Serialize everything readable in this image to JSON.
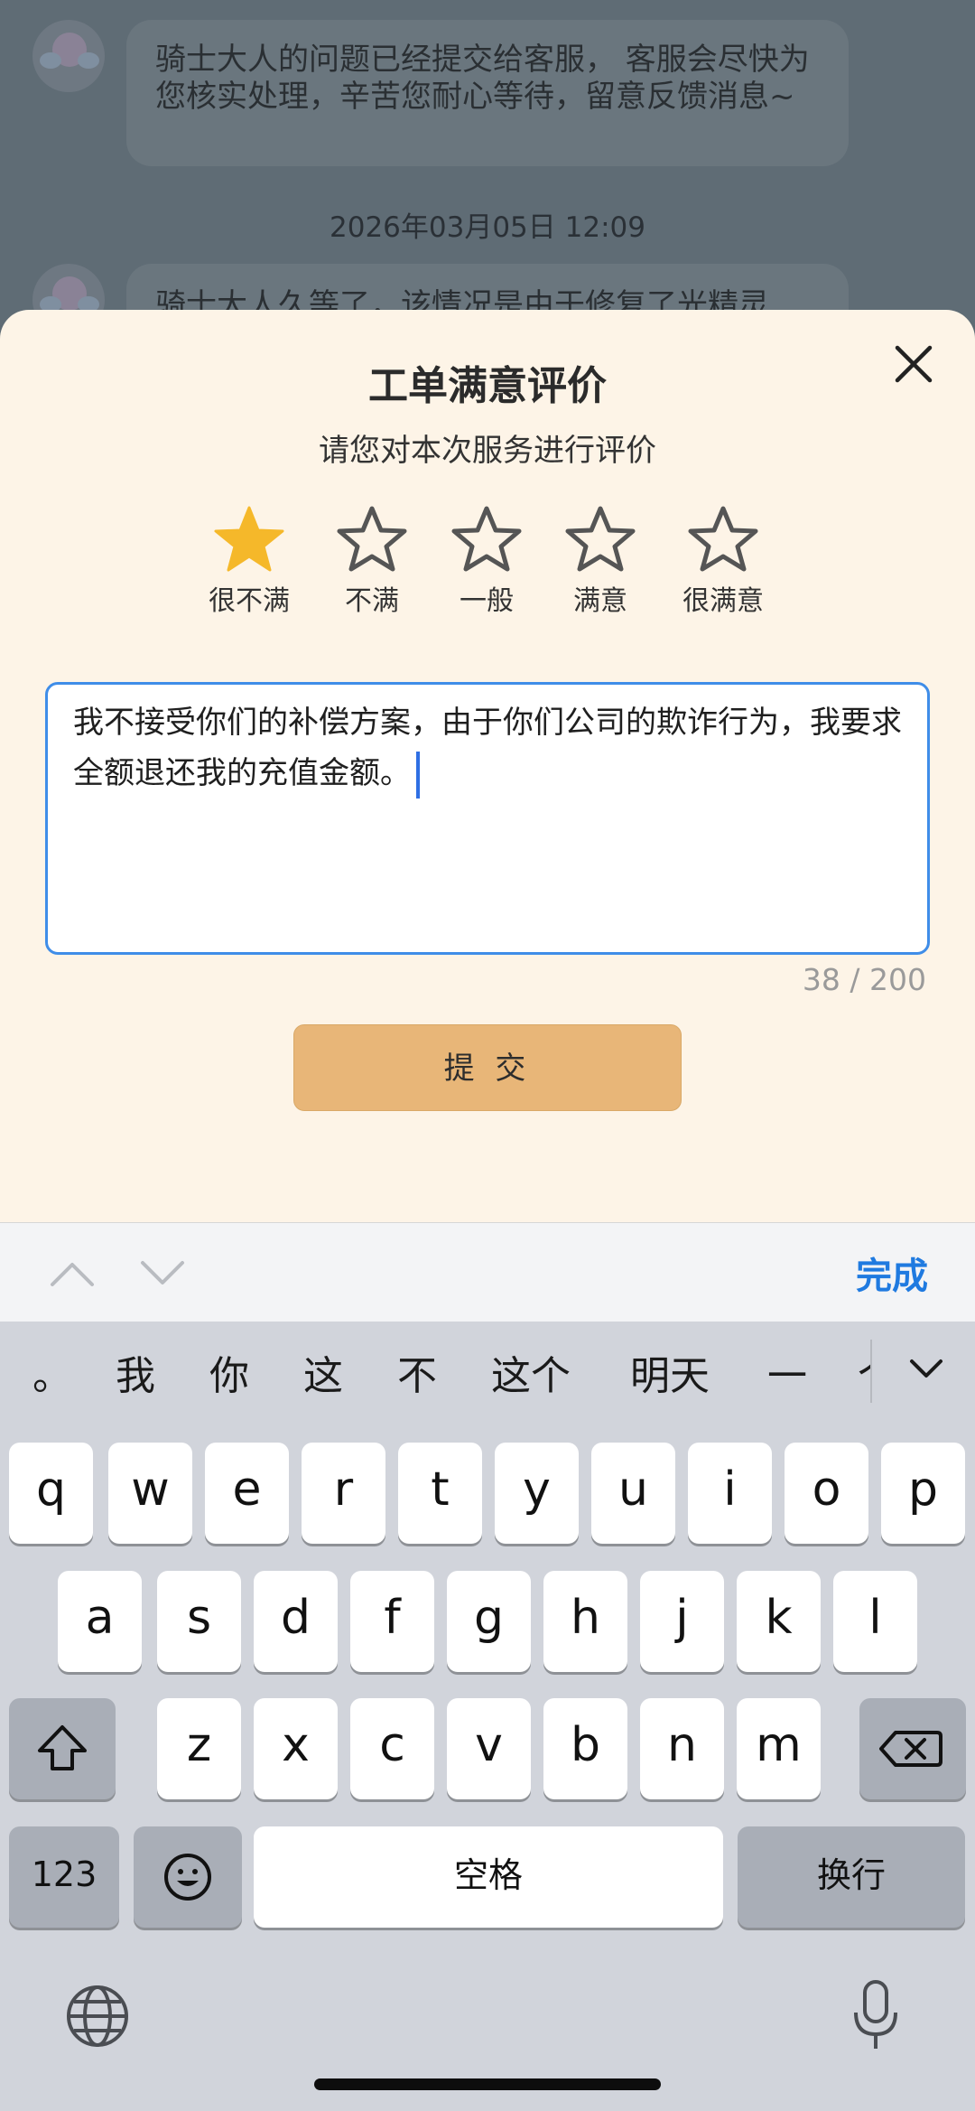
{
  "chat": {
    "message_1": "骑士大人的问题已经提交给客服， 客服会尽快为您核实处理，辛苦您耐心等待，留意反馈消息~",
    "timestamp": "2026年03月05日 12:09",
    "message_2": "骑士大人久等了，该情况是由于修复了光精灵"
  },
  "sheet": {
    "title": "工单满意评价",
    "subtitle": "请您对本次服务进行评价",
    "rating": 1,
    "rating_max": 5,
    "stars": [
      {
        "label": "很不满",
        "filled": true
      },
      {
        "label": "不满",
        "filled": false
      },
      {
        "label": "一般",
        "filled": false
      },
      {
        "label": "满意",
        "filled": false
      },
      {
        "label": "很满意",
        "filled": false
      }
    ],
    "feedback_text": "我不接受你们的补偿方案，由于你们公司的欺诈行为，我要求全额退还我的充值金额。",
    "counter": "38 / 200",
    "submit_label": "提 交"
  },
  "accessory": {
    "done_label": "完成"
  },
  "keyboard": {
    "candidates": [
      "。",
      "我",
      "你",
      "这",
      "不",
      "这个",
      "明天",
      "一",
      "个"
    ],
    "row1": [
      "q",
      "w",
      "e",
      "r",
      "t",
      "y",
      "u",
      "i",
      "o",
      "p"
    ],
    "row2": [
      "a",
      "s",
      "d",
      "f",
      "g",
      "h",
      "j",
      "k",
      "l"
    ],
    "row3": [
      "z",
      "x",
      "c",
      "v",
      "b",
      "n",
      "m"
    ],
    "numbers_label": "123",
    "space_label": "空格",
    "return_label": "换行"
  },
  "colors": {
    "star_filled": "#f5b82a",
    "star_outline": "#555555",
    "submit_bg": "#e8b678",
    "accent": "#1f7ae0",
    "sheet_bg": "#fdf4e7"
  }
}
